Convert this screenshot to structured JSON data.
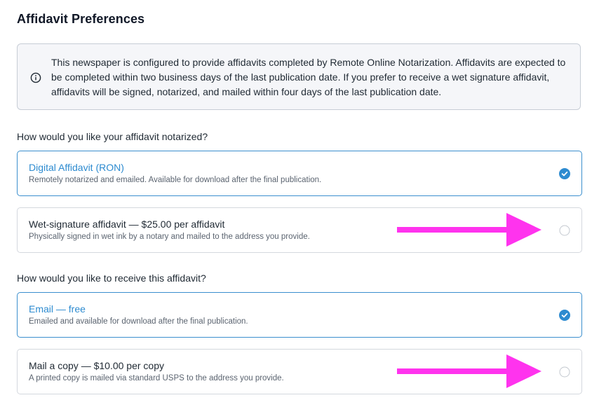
{
  "page": {
    "title": "Affidavit Preferences"
  },
  "notice": {
    "icon": "info-icon",
    "text": "This newspaper is configured to provide affidavits completed by Remote Online Notarization. Affidavits are expected to be completed within two business days of the last publication date. If you prefer to receive a wet signature affidavit, affidavits will be signed, notarized, and mailed within four days of the last publication date."
  },
  "notarization": {
    "question": "How would you like your affidavit notarized?",
    "options": [
      {
        "label": "Digital Affidavit (RON)",
        "description": "Remotely notarized and emailed. Available for download after the final publication.",
        "selected": true
      },
      {
        "label": "Wet-signature affidavit — $25.00 per affidavit",
        "description": "Physically signed in wet ink by a notary and mailed to the address you provide.",
        "selected": false
      }
    ]
  },
  "delivery": {
    "question": "How would you like to receive this affidavit?",
    "options": [
      {
        "label": "Email — free",
        "description": "Emailed and available for download after the final publication.",
        "selected": true
      },
      {
        "label": "Mail a copy — $10.00 per copy",
        "description": "A printed copy is mailed via standard USPS to the address you provide.",
        "selected": false
      }
    ]
  },
  "colors": {
    "accent": "#2d8bd0",
    "annotation_arrow": "#ff33ee",
    "notice_bg": "#f5f6f9"
  }
}
